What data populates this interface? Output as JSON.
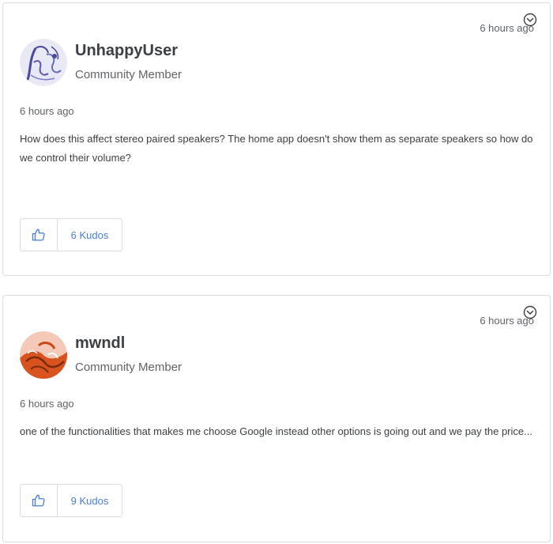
{
  "posts": [
    {
      "author": "UnhappyUser",
      "role": "Community Member",
      "header_time": "6 hours ago",
      "meta_time": "6 hours ago",
      "body": "How does this affect stereo paired speakers? The home app doesn't show them as separate speakers so how do we control their volume?",
      "kudos_label": "6 Kudos",
      "avatar_icon": "sketch-avatar"
    },
    {
      "author": "mwndl",
      "role": "Community Member",
      "header_time": "6 hours ago",
      "meta_time": "6 hours ago",
      "body": "one of the functionalities that makes me choose Google instead other options is going out and we pay the price...",
      "kudos_label": "9 Kudos",
      "avatar_icon": "orange-art-avatar"
    }
  ],
  "colors": {
    "accent": "#4a7fd4",
    "border": "#dadce0",
    "text": "#3c4043",
    "muted": "#5f6368"
  },
  "icons": {
    "menu": "chevron-down-circle-icon",
    "kudos": "thumbs-up-icon"
  }
}
